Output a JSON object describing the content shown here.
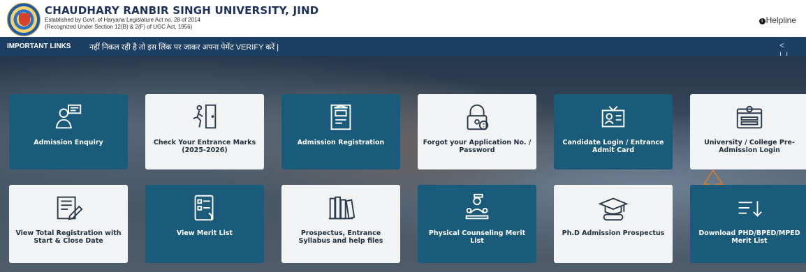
{
  "header": {
    "university_name": "CHAUDHARY RANBIR SINGH UNIVERSITY, JIND",
    "subtitle_1": "Established by Govt. of Haryana Legislature Act no. 28 of 2014",
    "subtitle_2": "(Recognized Under Section 12(B) & 2(F) of UGC Act, 1956)",
    "helpline_label": "Helpline"
  },
  "ticker": {
    "label": "IMPORTANT LINKS",
    "text": "नहीं निकल रही है तो इस लिंक पर जाकर अपना पेमेंट VERIFY करें |",
    "controls": "< ||"
  },
  "tiles_row1": [
    {
      "label": "Admission Enquiry",
      "icon": "enquiry-icon",
      "style": "dark"
    },
    {
      "label": "Check Your Entrance Marks (2025-2026)",
      "icon": "exit-door-icon",
      "style": "light"
    },
    {
      "label": "Admission Registration",
      "icon": "registration-icon",
      "style": "dark"
    },
    {
      "label": "Forgot your Application No. / Password",
      "icon": "lock-icon",
      "style": "light"
    },
    {
      "label": "Candidate Login / Entrance Admit Card",
      "icon": "admit-card-icon",
      "style": "dark"
    },
    {
      "label": "University / College Pre-Admission Login",
      "icon": "login-icon",
      "style": "light"
    }
  ],
  "tiles_row2": [
    {
      "label": "View Total Registration with Start & Close Date",
      "icon": "edit-document-icon",
      "style": "light"
    },
    {
      "label": "View Merit List",
      "icon": "merit-list-icon",
      "style": "dark"
    },
    {
      "label": "Prospectus, Entrance Syllabus and help files",
      "icon": "books-icon",
      "style": "light"
    },
    {
      "label": "Physical Counseling Merit List",
      "icon": "counseling-icon",
      "style": "dark"
    },
    {
      "label": "Ph.D Admission Prospectus",
      "icon": "graduation-cap-icon",
      "style": "light"
    },
    {
      "label": "Download PHD/BPED/MPED Merit List",
      "icon": "download-list-icon",
      "style": "dark"
    }
  ],
  "colors": {
    "ticker_bg": "#1d3f63",
    "tile_dark": "#1a5a7a",
    "tile_light": "#f1f3f5",
    "annotation_arrow": "#c77a3a"
  }
}
